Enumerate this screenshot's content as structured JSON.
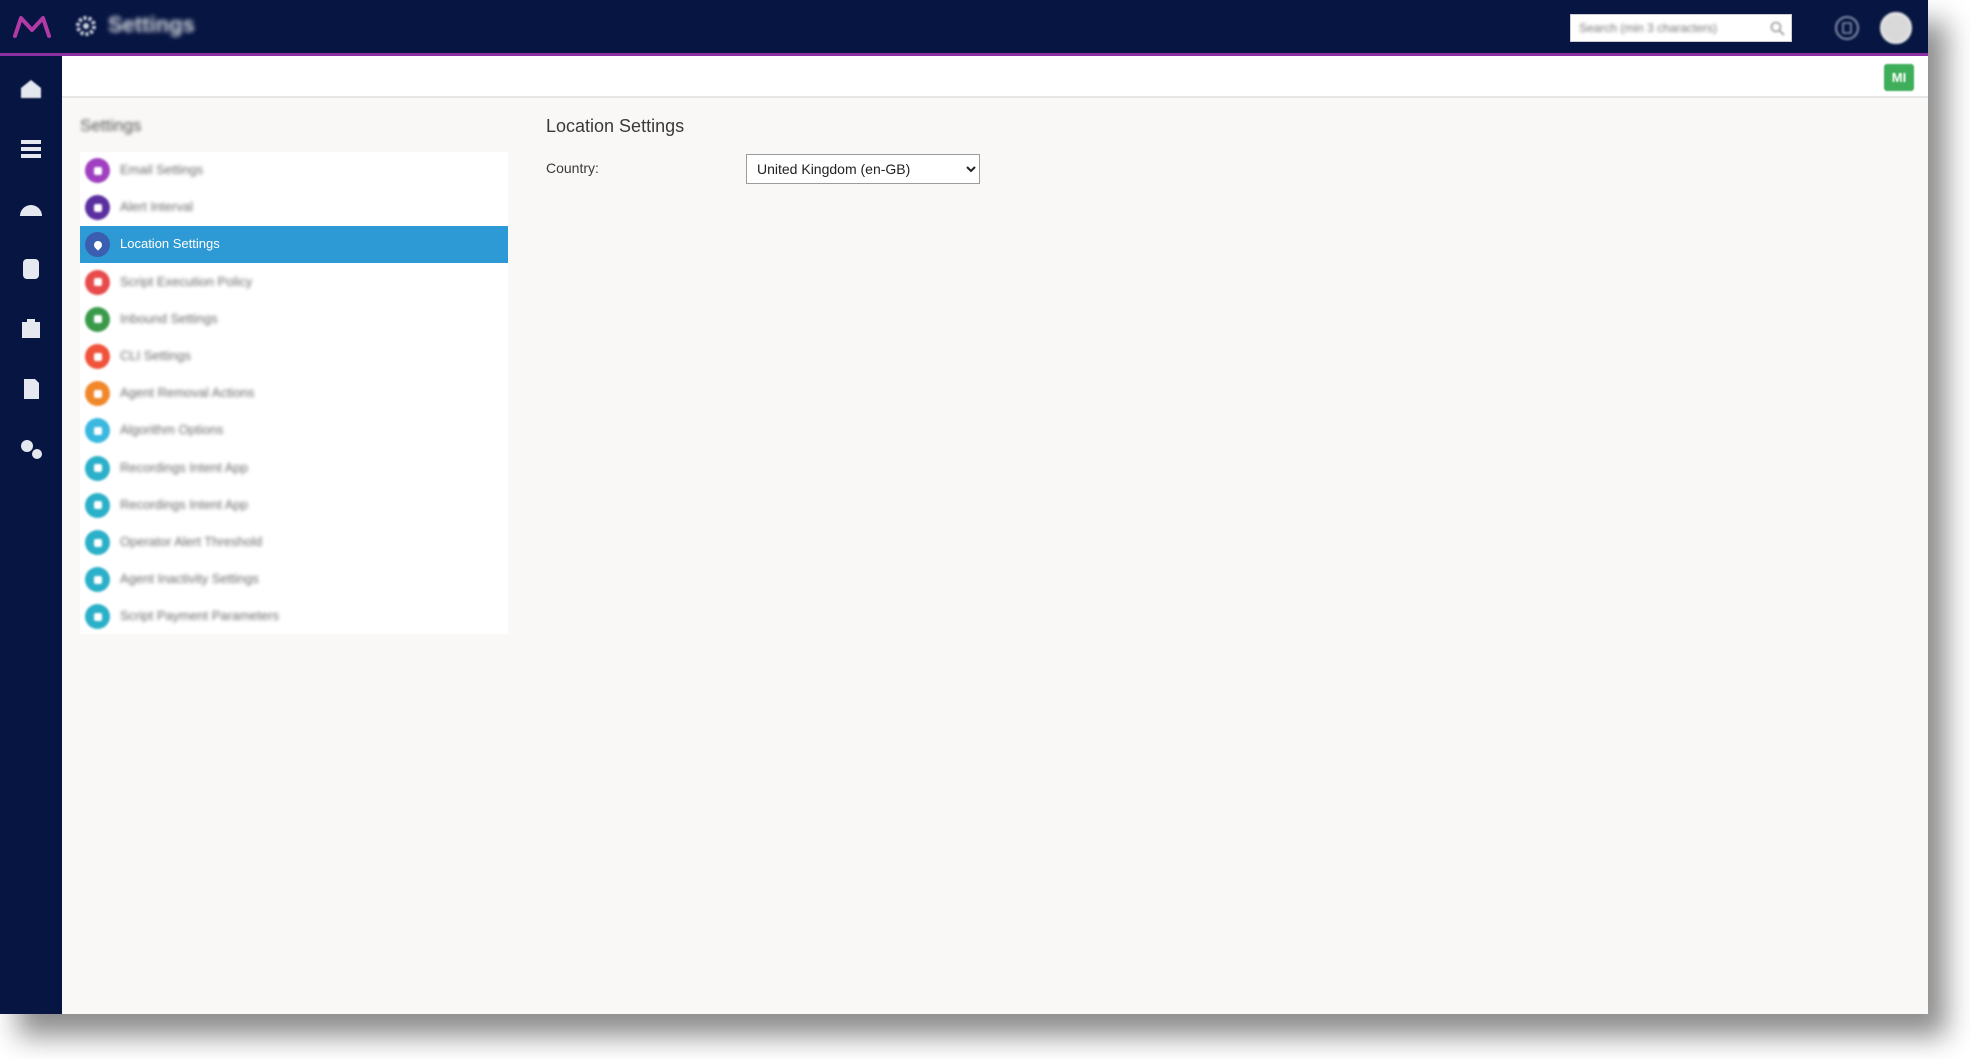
{
  "app": {
    "title": "Settings",
    "search_placeholder": "Search (min 3 characters)",
    "action_badge": "MI"
  },
  "colors": {
    "topbar": "#061541",
    "accent": "#8b2fa3",
    "active_item": "#2d9ad5",
    "action_button": "#3fae5a"
  },
  "nav_icons": [
    "home-icon",
    "grid-icon",
    "dashboard-icon",
    "database-icon",
    "reports-icon",
    "document-icon",
    "settings-gears-icon"
  ],
  "sidebar": {
    "heading": "Settings",
    "items": [
      {
        "label": "Email Settings",
        "color": "#a040c0"
      },
      {
        "label": "Alert Interval",
        "color": "#5a2fa0"
      },
      {
        "label": "Location Settings",
        "color": "#3a5fb0",
        "active": true
      },
      {
        "label": "Script Execution Policy",
        "color": "#e84b4b"
      },
      {
        "label": "Inbound Settings",
        "color": "#3a9a4a"
      },
      {
        "label": "CLI Settings",
        "color": "#f0533a"
      },
      {
        "label": "Agent Removal Actions",
        "color": "#f0882a"
      },
      {
        "label": "Algorithm Options",
        "color": "#3ab8e0"
      },
      {
        "label": "Recordings Intent App",
        "color": "#2ab0c8"
      },
      {
        "label": "Recordings Intent App",
        "color": "#2ab0c8"
      },
      {
        "label": "Operator Alert Threshold",
        "color": "#2ab0c8"
      },
      {
        "label": "Agent Inactivity Settings",
        "color": "#2ab0c8"
      },
      {
        "label": "Script Payment Parameters",
        "color": "#2ab0c8"
      }
    ]
  },
  "main": {
    "title": "Location Settings",
    "country_label": "Country:",
    "country_value": "United Kingdom (en-GB)"
  }
}
